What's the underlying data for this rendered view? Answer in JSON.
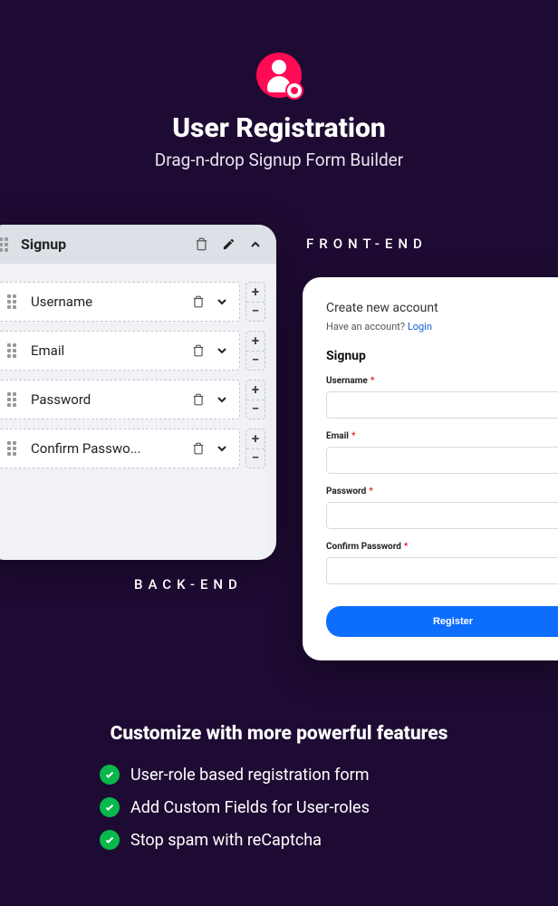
{
  "hero": {
    "title": "User Registration",
    "subtitle": "Drag-n-drop Signup Form Builder"
  },
  "labels": {
    "frontend": "FRONT-END",
    "backend": "BACK-END"
  },
  "backend": {
    "title": "Signup",
    "fields": [
      {
        "label": "Username"
      },
      {
        "label": "Email"
      },
      {
        "label": "Password"
      },
      {
        "label": "Confirm Passwo..."
      }
    ]
  },
  "frontend": {
    "title": "Create new account",
    "have_account": "Have an account?",
    "login": "Login",
    "heading": "Signup",
    "fields": [
      {
        "label": "Username"
      },
      {
        "label": "Email"
      },
      {
        "label": "Password"
      },
      {
        "label": "Confirm Password"
      }
    ],
    "button": "Register"
  },
  "features": {
    "heading": "Customize with more powerful features",
    "items": [
      "User-role based registration form",
      "Add Custom Fields for User-roles",
      "Stop spam with reCaptcha"
    ]
  }
}
